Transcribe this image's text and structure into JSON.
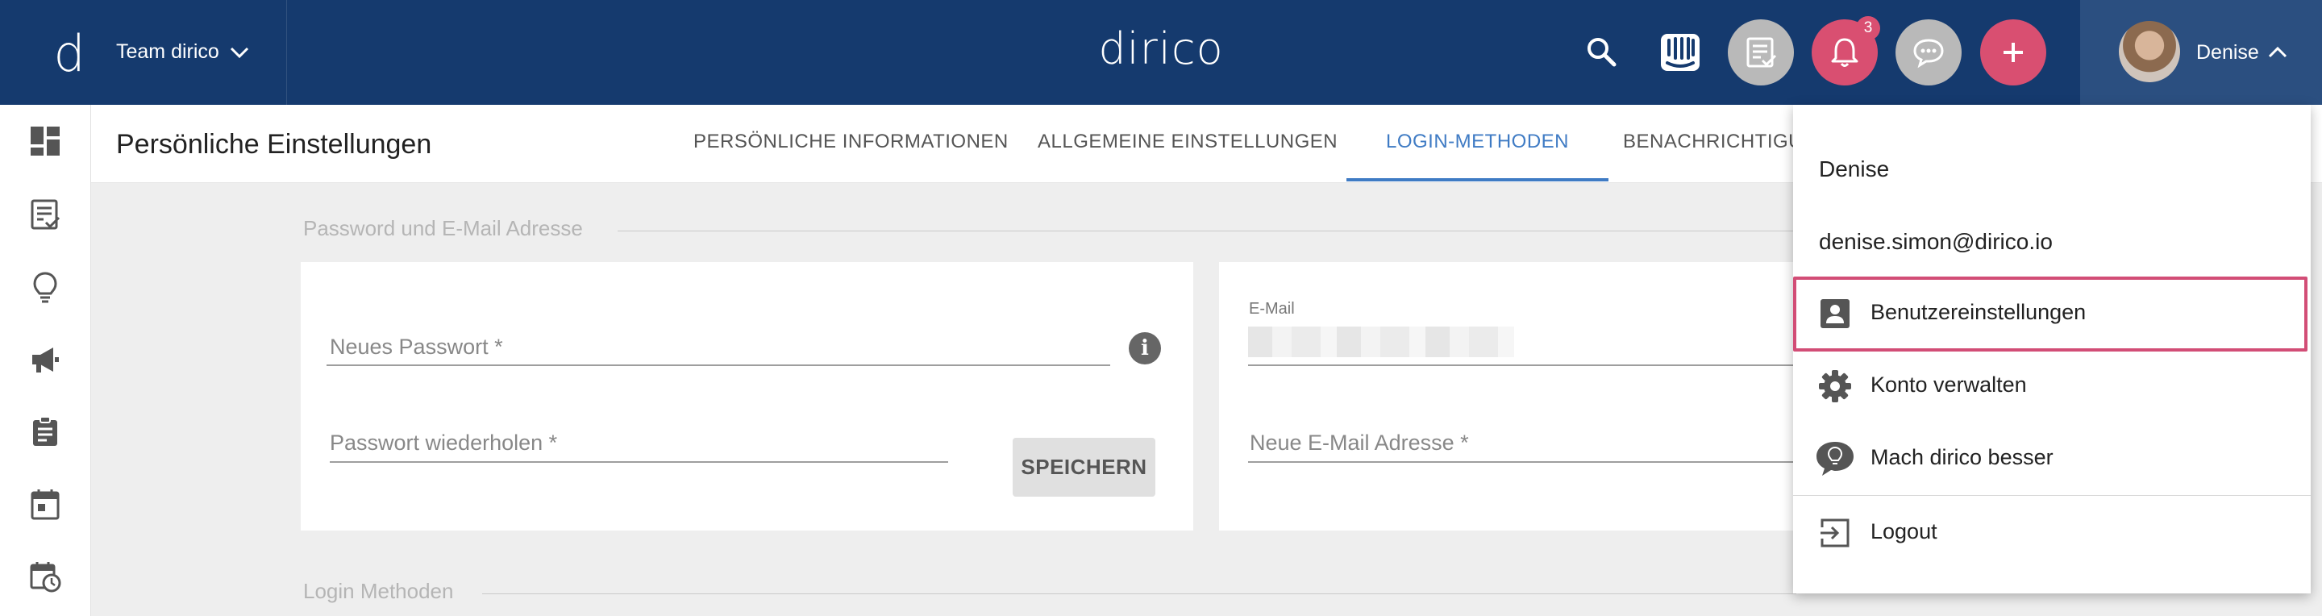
{
  "topbar": {
    "team_logo": "d",
    "team_name": "Team dirico",
    "brand": "dirico",
    "notification_count": "3",
    "user_name": "Denise",
    "icons": [
      "search-icon",
      "intercom-icon",
      "tasks-icon",
      "bell-icon",
      "chat-icon",
      "plus-icon"
    ],
    "colors": {
      "bar": "#153a6e",
      "user_area": "#2b4f80",
      "pink": "#d94f71",
      "gray_button": "#b8b8b8"
    }
  },
  "leftnav": {
    "icons": [
      "dashboard-icon",
      "checklist-icon",
      "lightbulb-icon",
      "megaphone-icon",
      "clipboard-icon",
      "calendar-icon",
      "calendar-clock-icon"
    ]
  },
  "subheader": {
    "title": "Persönliche Einstellungen",
    "tabs": [
      {
        "label": "PERSÖNLICHE INFORMATIONEN",
        "active": false
      },
      {
        "label": "ALLGEMEINE EINSTELLUNGEN",
        "active": false
      },
      {
        "label": "LOGIN-METHODEN",
        "active": true
      },
      {
        "label": "BENACHRICHTIGU",
        "active": false
      }
    ],
    "accent": "#3f7bc4"
  },
  "main": {
    "section_password_email": "Password und E-Mail Adresse",
    "section_login_methods": "Login Methoden",
    "password_card": {
      "new_password_label": "Neues Passwort *",
      "repeat_password_label": "Passwort wiederholen *",
      "save_label": "SPEICHERN"
    },
    "email_card": {
      "email_label": "E-Mail",
      "new_email_label": "Neue E-Mail Adresse *"
    }
  },
  "dropdown": {
    "name": "Denise",
    "email": "denise.simon@dirico.io",
    "items": [
      {
        "label": "Benutzereinstellungen",
        "icon": "account-box-icon",
        "highlighted": true
      },
      {
        "label": "Konto verwalten",
        "icon": "gear-icon"
      },
      {
        "label": "Mach dirico besser",
        "icon": "feedback-bulb-icon"
      },
      {
        "label": "Logout",
        "icon": "logout-icon"
      }
    ],
    "highlight_color": "#d24d76"
  }
}
